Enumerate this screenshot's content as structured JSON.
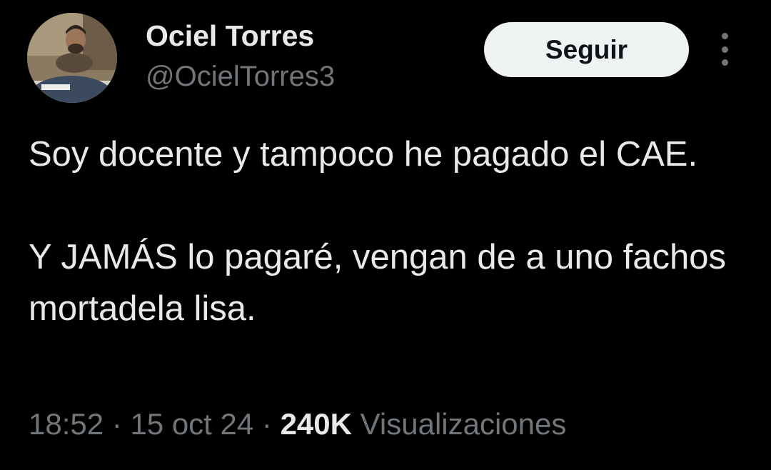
{
  "author": {
    "display_name": "Ociel Torres",
    "handle": "@OcielTorres3"
  },
  "actions": {
    "follow_label": "Seguir",
    "more_icon": "more-vertical-icon"
  },
  "tweet": {
    "paragraph_1": "Soy docente y tampoco he pagado el CAE.",
    "paragraph_2": "Y JAMÁS lo pagaré, vengan de a uno fachos mortadela lisa."
  },
  "meta": {
    "time": "18:52",
    "separator_1": " · ",
    "date": "15 oct 24",
    "separator_2": " · ",
    "views_count": "240K",
    "views_label": " Visualizaciones"
  },
  "colors": {
    "background": "#000000",
    "primary_text": "#e7e9ea",
    "secondary_text": "#71767b",
    "button_bg": "#eff3f4",
    "button_text": "#0f1419"
  }
}
